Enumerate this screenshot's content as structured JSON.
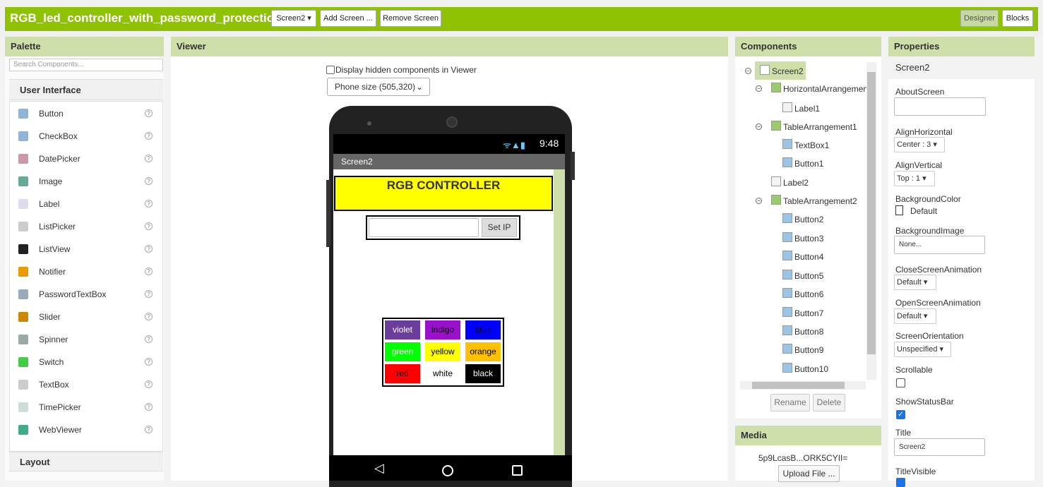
{
  "app": {
    "title": "RGB_led_controller_with_password_protection"
  },
  "toolbar": {
    "screen_select": "Screen2 ▾",
    "add_screen": "Add Screen ...",
    "remove_screen": "Remove Screen",
    "designer": "Designer",
    "blocks": "Blocks"
  },
  "palette": {
    "title": "Palette",
    "search_placeholder": "Search Components...",
    "section": "User Interface",
    "items": [
      {
        "label": "Button",
        "icon": "button-icon"
      },
      {
        "label": "CheckBox",
        "icon": "checkbox-icon"
      },
      {
        "label": "DatePicker",
        "icon": "datepicker-icon"
      },
      {
        "label": "Image",
        "icon": "image-icon"
      },
      {
        "label": "Label",
        "icon": "label-icon"
      },
      {
        "label": "ListPicker",
        "icon": "listpicker-icon"
      },
      {
        "label": "ListView",
        "icon": "listview-icon"
      },
      {
        "label": "Notifier",
        "icon": "notifier-icon"
      },
      {
        "label": "PasswordTextBox",
        "icon": "password-icon"
      },
      {
        "label": "Slider",
        "icon": "slider-icon"
      },
      {
        "label": "Spinner",
        "icon": "spinner-icon"
      },
      {
        "label": "Switch",
        "icon": "switch-icon"
      },
      {
        "label": "TextBox",
        "icon": "textbox-icon"
      },
      {
        "label": "TimePicker",
        "icon": "timepicker-icon"
      },
      {
        "label": "WebViewer",
        "icon": "webviewer-icon"
      }
    ],
    "layout_section": "Layout"
  },
  "viewer": {
    "title": "Viewer",
    "hidden_label": "Display hidden components in Viewer",
    "phone_size": "Phone size (505,320)",
    "status_time": "9:48",
    "screen_title": "Screen2",
    "heading": "RGB CONTROLLER",
    "set_ip": "Set IP",
    "colors": [
      {
        "label": "violet",
        "bg": "#6a3d9a",
        "fg": "#ffffff"
      },
      {
        "label": "indigo",
        "bg": "#9b10cc",
        "fg": "#000000"
      },
      {
        "label": "blue",
        "bg": "#0000ff",
        "fg": "#000000"
      },
      {
        "label": "green",
        "bg": "#00ff00",
        "fg": "#ffffff"
      },
      {
        "label": "yellow",
        "bg": "#ffff00",
        "fg": "#000000"
      },
      {
        "label": "orange",
        "bg": "#ffc000",
        "fg": "#000000"
      },
      {
        "label": "red",
        "bg": "#ff0000",
        "fg": "#000000"
      },
      {
        "label": "white",
        "bg": "#ffffff",
        "fg": "#000000"
      },
      {
        "label": "black",
        "bg": "#000000",
        "fg": "#ffffff"
      }
    ]
  },
  "components": {
    "title": "Components",
    "tree": [
      "Screen2",
      "HorizontalArrangemen",
      "Label1",
      "TableArrangement1",
      "TextBox1",
      "Button1",
      "Label2",
      "TableArrangement2",
      "Button2",
      "Button3",
      "Button4",
      "Button5",
      "Button6",
      "Button7",
      "Button8",
      "Button9",
      "Button10"
    ],
    "rename": "Rename",
    "delete": "Delete"
  },
  "media": {
    "title": "Media",
    "file": "5p9LcasB...ORK5CYII=",
    "upload": "Upload File ..."
  },
  "properties": {
    "title": "Properties",
    "screen": "Screen2",
    "about_label": "AboutScreen",
    "align_h_label": "AlignHorizontal",
    "align_h": "Center : 3 ▾",
    "align_v_label": "AlignVertical",
    "align_v": "Top : 1 ▾",
    "bgcolor_label": "BackgroundColor",
    "bgcolor": "Default",
    "bgimage_label": "BackgroundImage",
    "bgimage": "None...",
    "close_anim_label": "CloseScreenAnimation",
    "close_anim": "Default ▾",
    "open_anim_label": "OpenScreenAnimation",
    "open_anim": "Default ▾",
    "orientation_label": "ScreenOrientation",
    "orientation": "Unspecified ▾",
    "scrollable_label": "Scrollable",
    "statusbar_label": "ShowStatusBar",
    "title_label": "Title",
    "title_value": "Screen2",
    "titlevisible_label": "TitleVisible"
  }
}
